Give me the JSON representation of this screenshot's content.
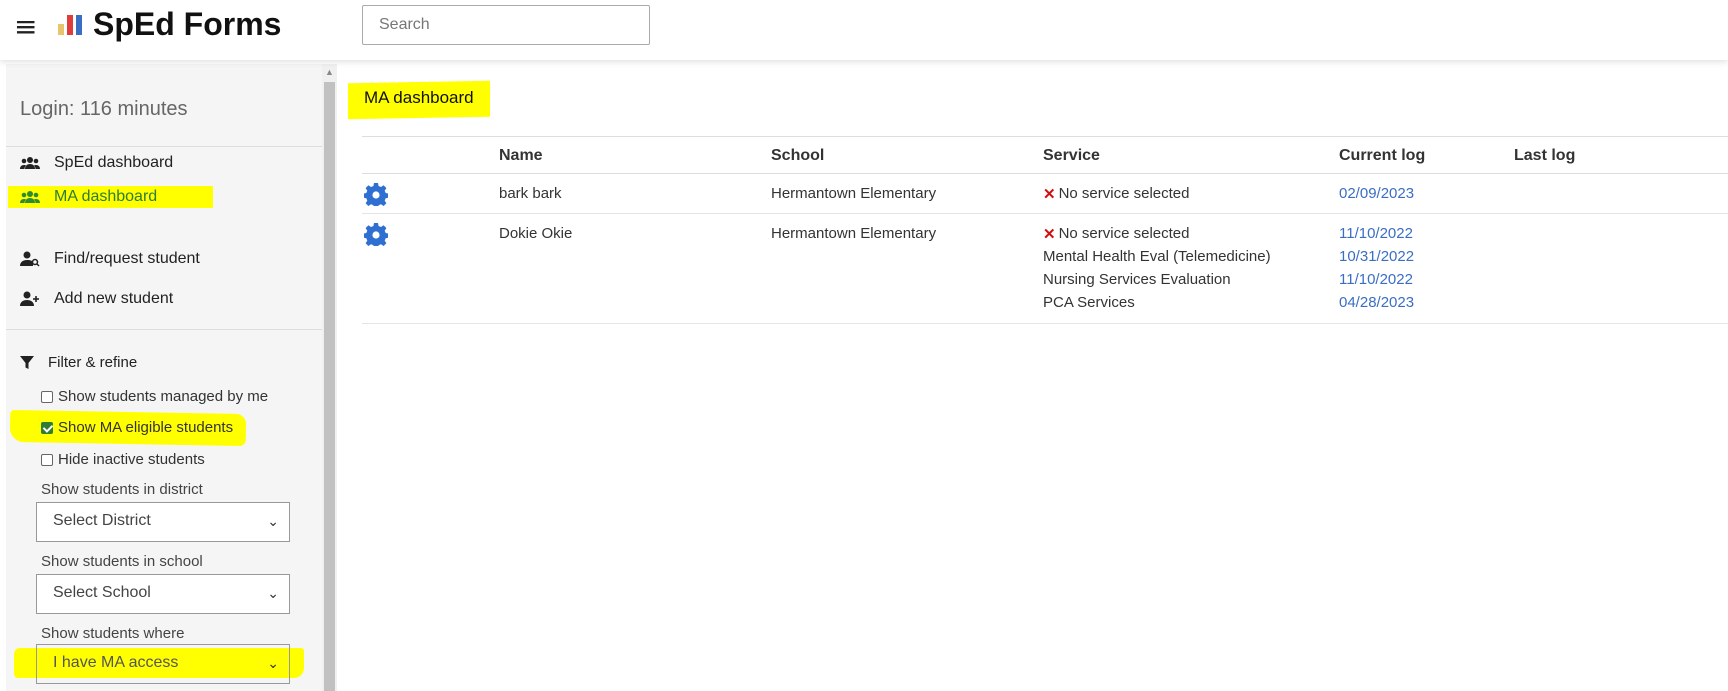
{
  "header": {
    "menu_icon": "hamburger-icon",
    "brand": "SpEd Forms",
    "logo_colors": [
      "#e8c56a",
      "#e03c3c",
      "#3a6ec4"
    ],
    "search_placeholder": "Search"
  },
  "sidebar": {
    "login_text": "Login: 116 minutes",
    "nav": [
      {
        "label": "SpEd dashboard",
        "icon": "users-icon"
      },
      {
        "label": "MA dashboard",
        "icon": "users-icon",
        "active": true
      },
      {
        "label": "Find/request student",
        "icon": "user-search-icon"
      },
      {
        "label": "Add new student",
        "icon": "user-plus-icon"
      }
    ],
    "filter": {
      "title": "Filter & refine",
      "checkboxes": [
        {
          "label": "Show students managed by me",
          "checked": false
        },
        {
          "label": "Show MA eligible students",
          "checked": true
        },
        {
          "label": "Hide inactive students",
          "checked": false
        }
      ],
      "district_label": "Show students in district",
      "district_value": "Select District",
      "school_label": "Show students in school",
      "school_value": "Select School",
      "where_label": "Show students where",
      "where_value": "I have MA access"
    }
  },
  "main": {
    "title": "MA dashboard",
    "columns": [
      "Name",
      "School",
      "Service",
      "Current log",
      "Last log"
    ],
    "rows": [
      {
        "name": "bark bark",
        "school": "Hermantown Elementary",
        "services": [
          {
            "text": "No service selected",
            "error": true
          }
        ],
        "current_logs": [
          "02/09/2023"
        ]
      },
      {
        "name": "Dokie Okie",
        "school": "Hermantown Elementary",
        "services": [
          {
            "text": "No service selected",
            "error": true
          },
          {
            "text": "Mental Health Eval (Telemedicine)"
          },
          {
            "text": "Nursing Services Evaluation"
          },
          {
            "text": "PCA Services"
          }
        ],
        "current_logs": [
          "11/10/2022",
          "10/31/2022",
          "11/10/2022",
          "04/28/2023"
        ]
      }
    ]
  },
  "colors": {
    "highlight": "#ffff00",
    "link": "#3a6ec4",
    "gear": "#2f6fd1",
    "error": "#d01010"
  }
}
